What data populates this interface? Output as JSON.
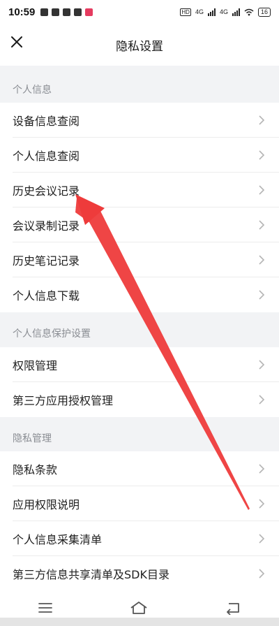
{
  "status_bar": {
    "time": "10:59",
    "network_1": "4G",
    "network_2": "4G",
    "battery": "16"
  },
  "header": {
    "title": "隐私设置",
    "close_icon": "close-icon"
  },
  "sections": [
    {
      "title": "个人信息",
      "items": [
        "设备信息查阅",
        "个人信息查阅",
        "历史会议记录",
        "会议录制记录",
        "历史笔记记录",
        "个人信息下载"
      ]
    },
    {
      "title": "个人信息保护设置",
      "items": [
        "权限管理",
        "第三方应用授权管理"
      ]
    },
    {
      "title": "隐私管理",
      "items": [
        "隐私条款",
        "应用权限说明",
        "个人信息采集清单",
        "第三方信息共享清单及SDK目录"
      ]
    }
  ],
  "colors": {
    "background": "#f2f3f5",
    "row_background": "#ffffff",
    "section_text": "#8a8d93",
    "annotation_arrow": "#ee3b3b"
  },
  "bottom_nav": {
    "menu_icon": "menu-icon",
    "home_icon": "home-icon",
    "back_icon": "back-icon"
  }
}
